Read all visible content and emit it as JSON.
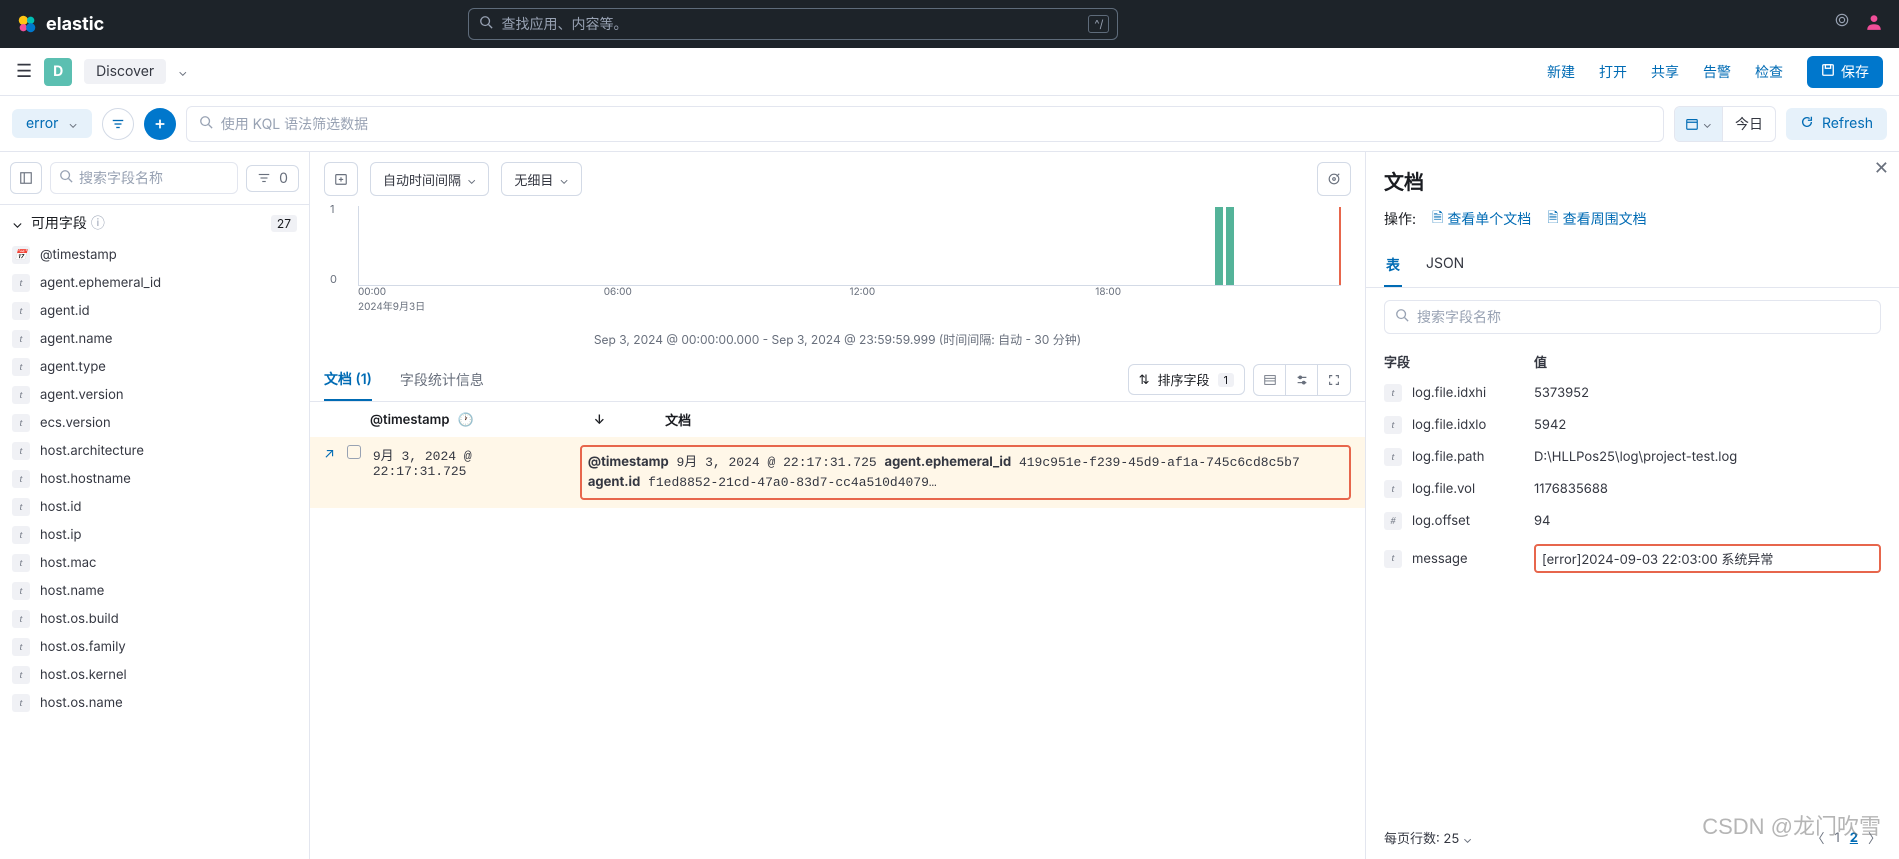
{
  "header": {
    "brand": "elastic",
    "search_placeholder": "查找应用、内容等。",
    "kbd_hint": "^/"
  },
  "app": {
    "badge": "D",
    "name": "Discover",
    "links": {
      "new": "新建",
      "open": "打开",
      "share": "共享",
      "alert": "告警",
      "inspect": "检查",
      "save": "保存"
    }
  },
  "filter": {
    "data_view": "error",
    "kql_placeholder": "使用 KQL 语法筛选数据",
    "date_label": "今日",
    "refresh": "Refresh"
  },
  "fields": {
    "search_placeholder": "搜索字段名称",
    "filter_count": "0",
    "available_label": "可用字段",
    "available_count": "27",
    "list": [
      {
        "type": "date",
        "name": "@timestamp"
      },
      {
        "type": "t",
        "name": "agent.ephemeral_id"
      },
      {
        "type": "t",
        "name": "agent.id"
      },
      {
        "type": "t",
        "name": "agent.name"
      },
      {
        "type": "t",
        "name": "agent.type"
      },
      {
        "type": "t",
        "name": "agent.version"
      },
      {
        "type": "t",
        "name": "ecs.version"
      },
      {
        "type": "t",
        "name": "host.architecture"
      },
      {
        "type": "t",
        "name": "host.hostname"
      },
      {
        "type": "t",
        "name": "host.id"
      },
      {
        "type": "t",
        "name": "host.ip"
      },
      {
        "type": "t",
        "name": "host.mac"
      },
      {
        "type": "t",
        "name": "host.name"
      },
      {
        "type": "t",
        "name": "host.os.build"
      },
      {
        "type": "t",
        "name": "host.os.family"
      },
      {
        "type": "t",
        "name": "host.os.kernel"
      },
      {
        "type": "t",
        "name": "host.os.name"
      }
    ]
  },
  "chart": {
    "interval_label": "自动时间间隔",
    "breakdown_label": "无细目",
    "y_ticks": [
      "1",
      "0"
    ],
    "x_ticks": [
      {
        "t": "00:00",
        "d": "2024年9月3日"
      },
      {
        "t": "06:00",
        "d": ""
      },
      {
        "t": "12:00",
        "d": ""
      },
      {
        "t": "18:00",
        "d": ""
      }
    ],
    "range_text": "Sep 3, 2024 @ 00:00:00.000 - Sep 3, 2024 @ 23:59:59.999   (时间间隔: 自动 - 30 分钟)"
  },
  "chart_data": {
    "type": "bar",
    "categories_hours": [
      22,
      22.5
    ],
    "values": [
      1,
      1
    ],
    "ylim": [
      0,
      1
    ],
    "x_range": [
      "2024-09-03 00:00",
      "2024-09-03 24:00"
    ],
    "title": "",
    "xlabel": "",
    "ylabel": ""
  },
  "docs": {
    "tab_docs": "文档 (1)",
    "tab_stats": "字段统计信息",
    "sort_label": "排序字段",
    "sort_count": "1",
    "col_ts": "@timestamp",
    "col_doc": "文档",
    "row_ts": "9月 3, 2024 @ 22:17:31.725",
    "row_doc": "@timestamp 9月 3, 2024 @ 22:17:31.725 agent.ephemeral_id 419c951e-f239-45d9-af1a-745c6cd8c5b7 agent.id f1ed8852-21cd-47a0-83d7-cc4a510d4079…"
  },
  "panel": {
    "title": "文档",
    "actions_label": "操作:",
    "action_single": "查看单个文档",
    "action_surround": "查看周围文档",
    "tab_table": "表",
    "tab_json": "JSON",
    "search_placeholder": "搜索字段名称",
    "col_field": "字段",
    "col_value": "值",
    "rows": [
      {
        "type": "t",
        "k": "log.file.idxhi",
        "v": "5373952"
      },
      {
        "type": "t",
        "k": "log.file.idxlo",
        "v": "5942"
      },
      {
        "type": "t",
        "k": "log.file.path",
        "v": "D:\\HLLPos25\\log\\project-test.log"
      },
      {
        "type": "t",
        "k": "log.file.vol",
        "v": "1176835688"
      },
      {
        "type": "#",
        "k": "log.offset",
        "v": "94"
      },
      {
        "type": "t",
        "k": "message",
        "v": "[error]2024-09-03 22:03:00 系统异常",
        "hl": true
      }
    ],
    "rowsper": "每页行数: 25",
    "page1": "1",
    "page2": "2"
  },
  "watermark": "CSDN @龙门吹雪"
}
